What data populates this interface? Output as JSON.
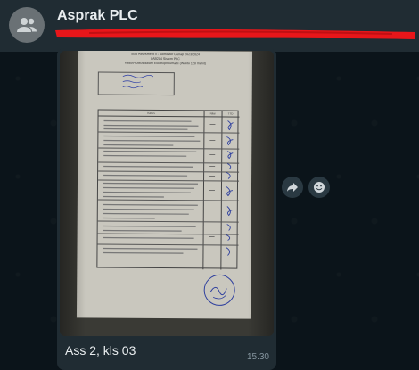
{
  "header": {
    "title": "Asprak PLC",
    "subtitle_redacted": "",
    "avatar_icon": "group-icon"
  },
  "message": {
    "caption": "Ass 2, kls 03",
    "time": "15.30",
    "photo_icon": "document-photo",
    "actions": {
      "forward_icon": "forward-icon",
      "emoji_icon": "emoji-icon"
    }
  },
  "document": {
    "heading_1": "Soal Assesment II - Semester Genap 2023/2024",
    "heading_2": "LAB204 Sistem PLC",
    "heading_3": "Kasus-Kasus dalam Electropneumatic (Waktu 120 menit)",
    "table_headers": [
      "Kasus",
      "Nilai",
      "TTD"
    ],
    "rows": [
      "1",
      "2",
      "3",
      "4",
      "5",
      "6",
      "7",
      "8",
      "9",
      "10"
    ]
  },
  "colors": {
    "header_bg": "#202c33",
    "bubble_bg": "#202c33",
    "app_bg": "#0b141a",
    "redaction": "#e8161a"
  }
}
